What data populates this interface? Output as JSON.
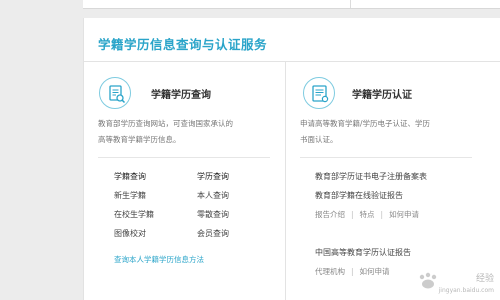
{
  "section": {
    "title": "学籍学历信息查询与认证服务"
  },
  "left_card": {
    "icon": "document-search-icon",
    "title": "学籍学历查询",
    "desc_line1": "教育部学历查询网站，可查询国家承认的",
    "desc_line2": "高等教育学籍学历信息。",
    "col1_header": "学籍查询",
    "col2_header": "学历查询",
    "col1_items": [
      "新生学籍",
      "在校生学籍",
      "图像校对"
    ],
    "col2_items": [
      "本人查询",
      "零散查询",
      "会员查询"
    ],
    "footer_link": "查询本人学籍学历信息方法"
  },
  "right_card": {
    "icon": "document-certificate-icon",
    "title": "学籍学历认证",
    "desc_line1": "申请高等教育学籍/学历电子认证、学历",
    "desc_line2": "书面认证。",
    "group1_line1": "教育部学历证书电子注册备案表",
    "group1_line2": "教育部学籍在线验证报告",
    "group1_links": [
      "报告介绍",
      "特点",
      "如何申请"
    ],
    "group2_line1": "中国高等教育学历认证报告",
    "group2_links": [
      "代理机构",
      "如何申请"
    ]
  },
  "watermark": {
    "line1": "经验",
    "line2": "jingyan.baidu.com"
  },
  "colors": {
    "accent": "#2aa4c9",
    "background": "#ececec"
  }
}
